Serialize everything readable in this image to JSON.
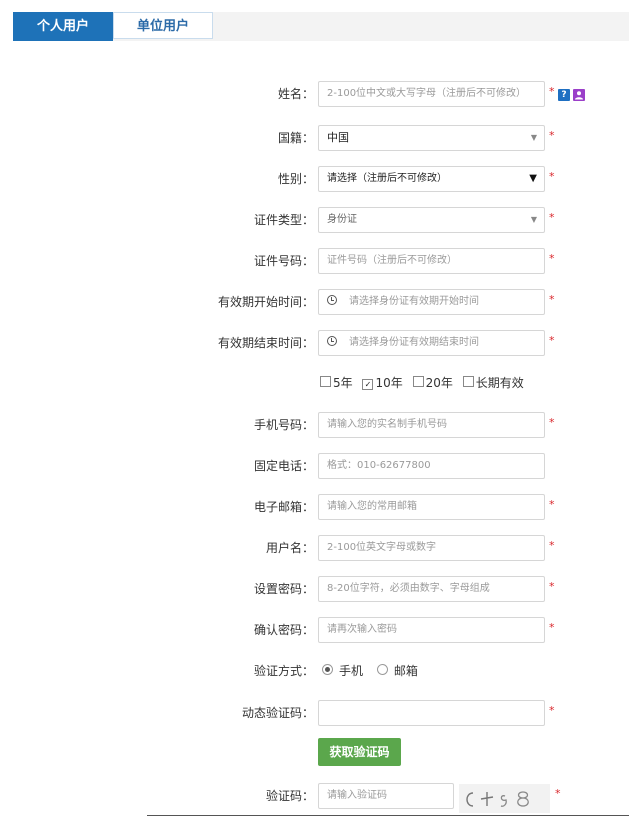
{
  "tabs": [
    {
      "label": "个人用户",
      "active": true
    },
    {
      "label": "单位用户",
      "active": false
    }
  ],
  "required_mark": "*",
  "form": {
    "name": {
      "label": "姓名：",
      "placeholder": "2-100位中文或大写字母（注册后不可修改）"
    },
    "help_icon": "?",
    "user_icon_text": "👤",
    "nationality": {
      "label": "国籍：",
      "value": "中国"
    },
    "gender": {
      "label": "性别：",
      "value": "请选择（注册后不可修改）"
    },
    "id_type": {
      "label": "证件类型：",
      "value": "身份证"
    },
    "id_number": {
      "label": "证件号码：",
      "placeholder": "证件号码（注册后不可修改）"
    },
    "valid_start": {
      "label": "有效期开始时间：",
      "placeholder": "请选择身份证有效期开始时间"
    },
    "valid_end": {
      "label": "有效期结束时间：",
      "placeholder": "请选择身份证有效期结束时间"
    },
    "validity_options": [
      {
        "label": "5年",
        "checked": false
      },
      {
        "label": "10年",
        "checked": true
      },
      {
        "label": "20年",
        "checked": false
      },
      {
        "label": "长期有效",
        "checked": false
      }
    ],
    "mobile": {
      "label": "手机号码：",
      "placeholder": "请输入您的实名制手机号码"
    },
    "phone": {
      "label": "固定电话：",
      "placeholder": "格式：010-62677800"
    },
    "email": {
      "label": "电子邮箱：",
      "placeholder": "请输入您的常用邮箱"
    },
    "username": {
      "label": "用户名：",
      "placeholder": "2-100位英文字母或数字"
    },
    "password": {
      "label": "设置密码：",
      "placeholder": "8-20位字符，必须由数字、字母组成"
    },
    "confirm_password": {
      "label": "确认密码：",
      "placeholder": "请再次输入密码"
    },
    "verify_method": {
      "label": "验证方式：",
      "options": [
        {
          "label": "手机",
          "selected": true
        },
        {
          "label": "邮箱",
          "selected": false
        }
      ]
    },
    "dynamic_code": {
      "label": "动态验证码：",
      "value": ""
    },
    "get_code_button": "获取验证码",
    "captcha": {
      "label": "验证码：",
      "placeholder": "请输入验证码",
      "image_text": "C+98"
    }
  }
}
